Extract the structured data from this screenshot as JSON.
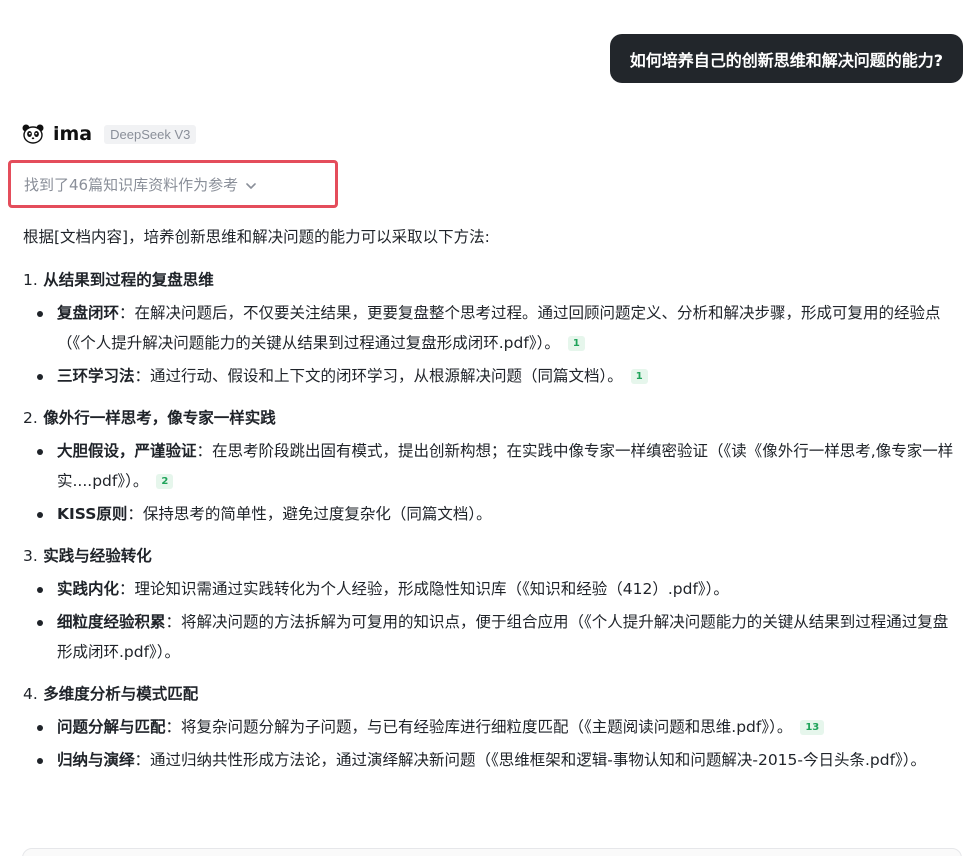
{
  "user_message": "如何培养自己的创新思维和解决问题的能力?",
  "bot": {
    "name": "ima",
    "model": "DeepSeek V3",
    "refs_label": "找到了46篇知识库资料作为参考"
  },
  "answer": {
    "intro": "根据[文档内容]，培养创新思维和解决问题的能力可以采取以下方法:",
    "sections": [
      {
        "num": "1.",
        "title": "从结果到过程的复盘思维",
        "items": [
          {
            "term": "复盘闭环",
            "text": "：在解决问题后，不仅要关注结果，更要复盘整个思考过程。通过回顾问题定义、分析和解决步骤，形成可复用的经验点（《个人提升解决问题能力的关键从结果到过程通过复盘形成闭环.pdf》）。",
            "cite": "1"
          },
          {
            "term": "三环学习法",
            "text": "：通过行动、假设和上下文的闭环学习，从根源解决问题（同篇文档）。",
            "cite": "1"
          }
        ]
      },
      {
        "num": "2.",
        "title": "像外行一样思考，像专家一样实践",
        "items": [
          {
            "term": "大胆假设，严谨验证",
            "text": "：在思考阶段跳出固有模式，提出创新构想；在实践中像专家一样缜密验证（《读《像外行一样思考,像专家一样实....pdf》）。",
            "cite": "2"
          },
          {
            "term": "KISS原则",
            "text": "：保持思考的简单性，避免过度复杂化（同篇文档）。",
            "cite": ""
          }
        ]
      },
      {
        "num": "3.",
        "title": "实践与经验转化",
        "items": [
          {
            "term": "实践内化",
            "text": "：理论知识需通过实践转化为个人经验，形成隐性知识库（《知识和经验（412）.pdf》）。",
            "cite": ""
          },
          {
            "term": "细粒度经验积累",
            "text": "：将解决问题的方法拆解为可复用的知识点，便于组合应用（《个人提升解决问题能力的关键从结果到过程通过复盘形成闭环.pdf》）。",
            "cite": ""
          }
        ]
      },
      {
        "num": "4.",
        "title": "多维度分析与模式匹配",
        "items": [
          {
            "term": "问题分解与匹配",
            "text": "：将复杂问题分解为子问题，与已有经验库进行细粒度匹配（《主题阅读问题和思维.pdf》）。",
            "cite": "13"
          },
          {
            "term": "归纳与演绎",
            "text": "：通过归纳共性形成方法论，通过演绎解决新问题（《思维框架和逻辑-事物认知和问题解决-2015-今日头条.pdf》）。",
            "cite": ""
          }
        ]
      }
    ]
  },
  "colors": {
    "user_bubble_bg": "#22262b",
    "refs_highlight_border": "#e44d5b",
    "cite_badge_bg": "#e6f6ec",
    "cite_badge_text": "#1fa35a"
  },
  "icons": {
    "bot_avatar": "panda-icon",
    "refs_toggle": "chevron-down-icon"
  }
}
